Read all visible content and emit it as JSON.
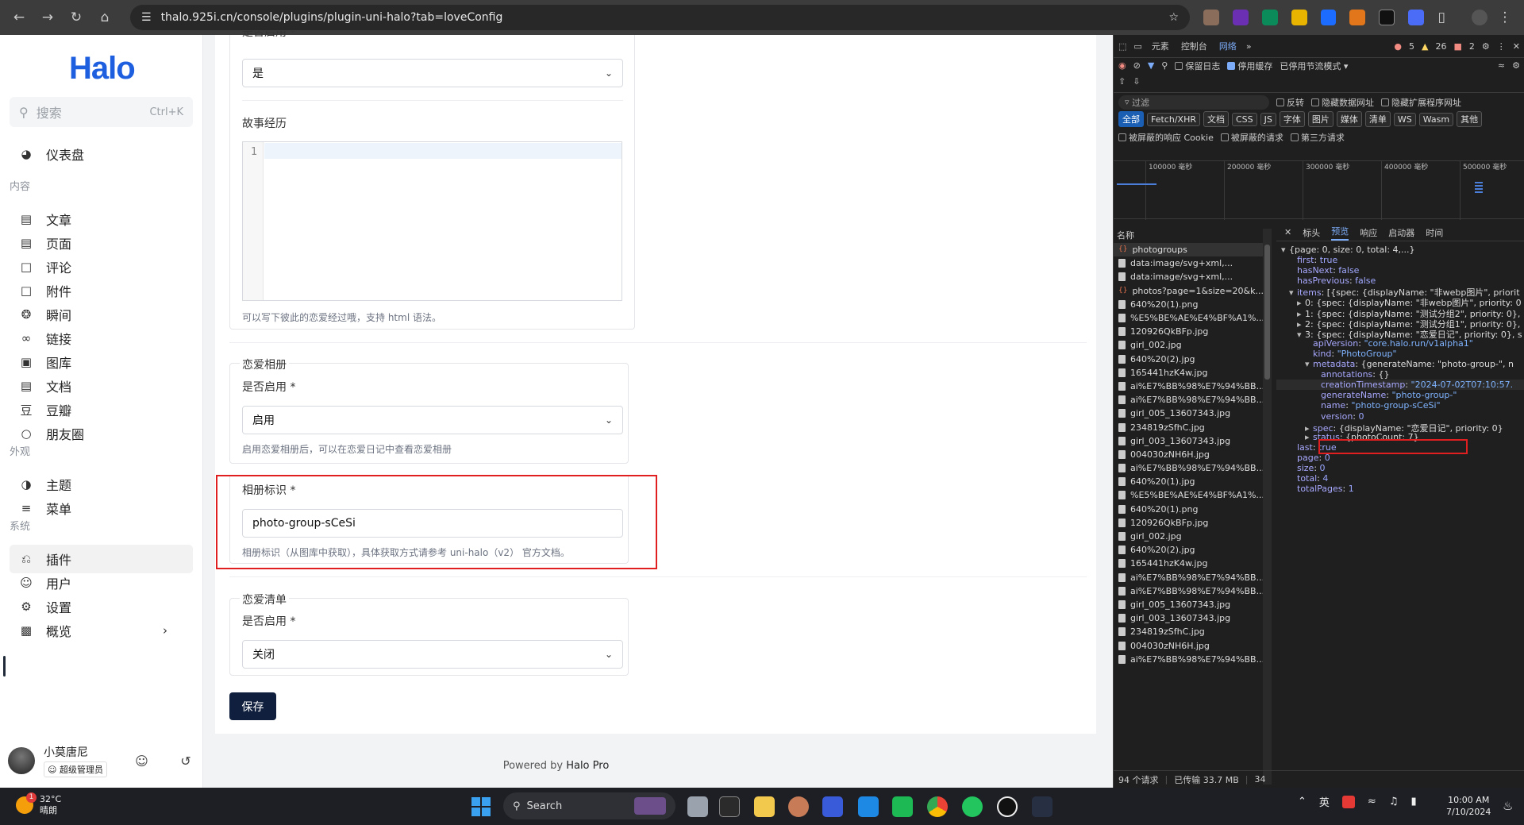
{
  "browser": {
    "url": "thalo.925i.cn/console/plugins/plugin-uni-halo?tab=loveConfig"
  },
  "sidebar": {
    "logo": "Halo",
    "search_placeholder": "搜索",
    "search_shortcut": "Ctrl+K",
    "dashboard": "仪表盘",
    "section_content": "内容",
    "section_appearance": "外观",
    "section_system": "系统",
    "items": [
      "文章",
      "页面",
      "评论",
      "附件",
      "瞬间",
      "链接",
      "图库",
      "文档",
      "豆瓣",
      "朋友圈"
    ],
    "appearance_items": [
      "主题",
      "菜单"
    ],
    "system_items": [
      "插件",
      "用户",
      "设置",
      "概览"
    ],
    "active_item": "插件",
    "user_name": "小莫唐尼",
    "user_role": "超级管理员"
  },
  "main": {
    "top_label": "是否启用 *",
    "top_select": "是",
    "story_label": "故事经历",
    "editor_line": "1",
    "story_help": "可以写下彼此的恋爱经过哦，支持 html 语法。",
    "album_group": "恋爱相册",
    "album_enable_label": "是否启用 *",
    "album_enable_value": "启用",
    "album_enable_help": "启用恋爱相册后，可以在恋爱日记中查看恋爱相册",
    "album_id_label": "相册标识 *",
    "album_id_value": "photo-group-sCeSi",
    "album_id_help": "相册标识（从图库中获取），具体获取方式请参考 uni-halo（v2） 官方文档。",
    "list_group": "恋爱清单",
    "list_enable_label": "是否启用 *",
    "list_enable_value": "关闭",
    "save_label": "保存",
    "footer_prefix": "Powered by ",
    "footer_brand": "Halo Pro"
  },
  "devtools": {
    "tabs": [
      "元素",
      "控制台",
      "网络"
    ],
    "active_tab": "网络",
    "errors": "5",
    "warnings": "26",
    "issues": "2",
    "preserve_log": "保留日志",
    "disable_cache": "停用缓存",
    "throttle": "已停用节流模式",
    "filter_placeholder": "过滤",
    "invert": "反转",
    "hide_data_urls": "隐藏数据网址",
    "hide_ext_urls": "隐藏扩展程序网址",
    "type_chips": [
      "全部",
      "Fetch/XHR",
      "文档",
      "CSS",
      "JS",
      "字体",
      "图片",
      "媒体",
      "清单",
      "WS",
      "Wasm",
      "其他"
    ],
    "blocked_cookies": "被屏蔽的响应 Cookie",
    "blocked_requests": "被屏蔽的请求",
    "third_party": "第三方请求",
    "ticks": [
      "100000 毫秒",
      "200000 毫秒",
      "300000 毫秒",
      "400000 毫秒",
      "500000 毫秒"
    ],
    "name_header": "名称",
    "requests": [
      "photogroups",
      "data:image/svg+xml,...",
      "data:image/svg+xml,...",
      "photos?page=1&size=20&k...",
      "640%20(1).png",
      "%E5%BE%AE%E4%BF%A1%...",
      "120926QkBFp.jpg",
      "girl_002.jpg",
      "640%20(2).jpg",
      "165441hzK4w.jpg",
      "ai%E7%BB%98%E7%94%BB...",
      "ai%E7%BB%98%E7%94%BB...",
      "girl_005_13607343.jpg",
      "234819zSfhC.jpg",
      "girl_003_13607343.jpg",
      "004030zNH6H.jpg",
      "ai%E7%BB%98%E7%94%BB...",
      "640%20(1).jpg",
      "%E5%BE%AE%E4%BF%A1%...",
      "640%20(1).png",
      "120926QkBFp.jpg",
      "girl_002.jpg",
      "640%20(2).jpg",
      "165441hzK4w.jpg",
      "ai%E7%BB%98%E7%94%BB...",
      "ai%E7%BB%98%E7%94%BB...",
      "girl_005_13607343.jpg",
      "girl_003_13607343.jpg",
      "234819zSfhC.jpg",
      "004030zNH6H.jpg",
      "ai%E7%BB%98%E7%94%BB..."
    ],
    "detail_tabs": [
      "标头",
      "预览",
      "响应",
      "启动器",
      "时间"
    ],
    "active_detail_tab": "预览",
    "preview": {
      "root": "{page: 0, size: 0, total: 4,...}",
      "first_k": "first",
      "first_v": "true",
      "hasNext_k": "hasNext",
      "hasNext_v": "false",
      "hasPrevious_k": "hasPrevious",
      "hasPrevious_v": "false",
      "items_k": "items",
      "items_v": "[{spec: {displayName: \"非webp图片\", priorit",
      "i0": "0: {spec: {displayName: \"非webp图片\", priority: 0",
      "i1": "1: {spec: {displayName: \"测试分组2\", priority: 0},",
      "i2": "2: {spec: {displayName: \"测试分组1\", priority: 0},",
      "i3": "3: {spec: {displayName: \"恋爱日记\", priority: 0}, s",
      "apiVersion_k": "apiVersion",
      "apiVersion_v": "\"core.halo.run/v1alpha1\"",
      "kind_k": "kind",
      "kind_v": "\"PhotoGroup\"",
      "metadata_k": "metadata",
      "metadata_v": "{generateName: \"photo-group-\", n",
      "annotations_k": "annotations",
      "annotations_v": "{}",
      "creation_k": "creationTimestamp",
      "creation_v": "\"2024-07-02T07:10:57.",
      "generateName_k": "generateName",
      "generateName_v": "\"photo-group-\"",
      "name_k": "name",
      "name_v": "\"photo-group-sCeSi\"",
      "version_k": "version",
      "version_v": "0",
      "spec_k": "spec",
      "spec_v": "{displayName: \"恋爱日记\", priority: 0}",
      "status_k": "status",
      "status_v": "{photoCount: 7}",
      "last_k": "last",
      "last_v": "true",
      "page_k": "page",
      "page_v": "0",
      "size_k": "size",
      "size_v": "0",
      "total_k": "total",
      "total_v": "4",
      "totalPages_k": "totalPages",
      "totalPages_v": "1"
    },
    "status_requests": "94 个请求",
    "status_transferred": "已传输 33.7 MB",
    "status_extra": "34"
  },
  "taskbar": {
    "temp": "32°C",
    "weather": "晴朗",
    "weather_badge": "1",
    "search": "Search",
    "ime": "英",
    "time": "10:00 AM",
    "date": "7/10/2024"
  }
}
